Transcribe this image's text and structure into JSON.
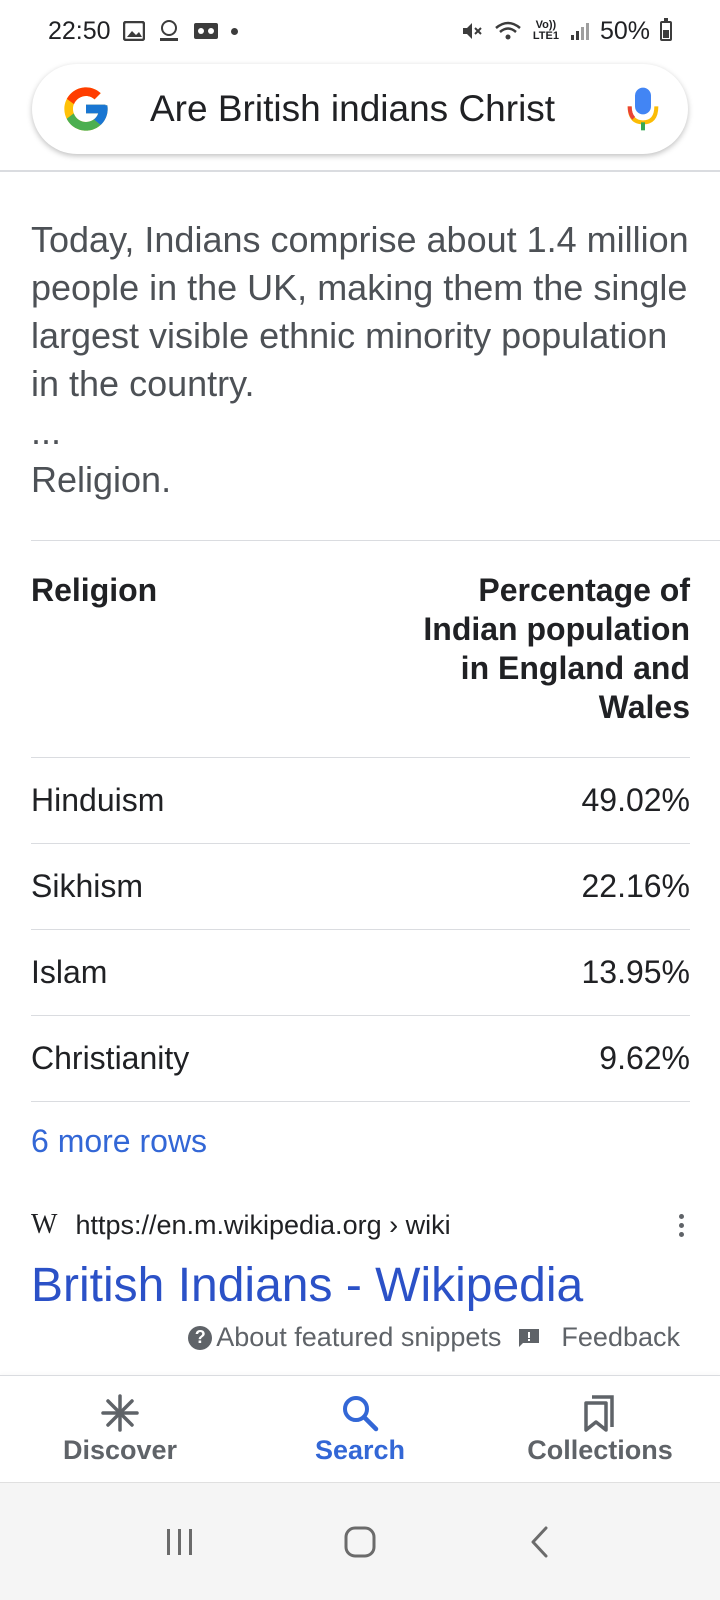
{
  "status_bar": {
    "time": "22:50",
    "signal_text": "Vo)) LTE1",
    "battery": "50%"
  },
  "search": {
    "query": "Are British indians Christ"
  },
  "snippet": {
    "text": "Today, Indians comprise about 1.4 million people in the UK, making them the single largest visible ethnic minority population in the country.",
    "ellipsis": "...",
    "section": "Religion."
  },
  "table": {
    "headers": [
      "Religion",
      "Percentage of Indian population in England and Wales"
    ],
    "rows": [
      {
        "religion": "Hinduism",
        "percentage": "49.02%"
      },
      {
        "religion": "Sikhism",
        "percentage": "22.16%"
      },
      {
        "religion": "Islam",
        "percentage": "13.95%"
      },
      {
        "religion": "Christianity",
        "percentage": "9.62%"
      }
    ],
    "more_rows": "6 more rows"
  },
  "result": {
    "favicon": "W",
    "url": "https://en.m.wikipedia.org › wiki",
    "title": "British Indians - Wikipedia"
  },
  "footer": {
    "about": "About featured snippets",
    "feedback": "Feedback"
  },
  "bottom_nav": [
    {
      "label": "Discover",
      "icon": "asterisk-icon",
      "active": false
    },
    {
      "label": "Search",
      "icon": "search-icon",
      "active": true
    },
    {
      "label": "Collections",
      "icon": "bookmarks-icon",
      "active": false
    }
  ],
  "colors": {
    "link": "#3367d6",
    "active_tab": "#3367d6",
    "text": "#202124",
    "muted": "#5f6368"
  }
}
